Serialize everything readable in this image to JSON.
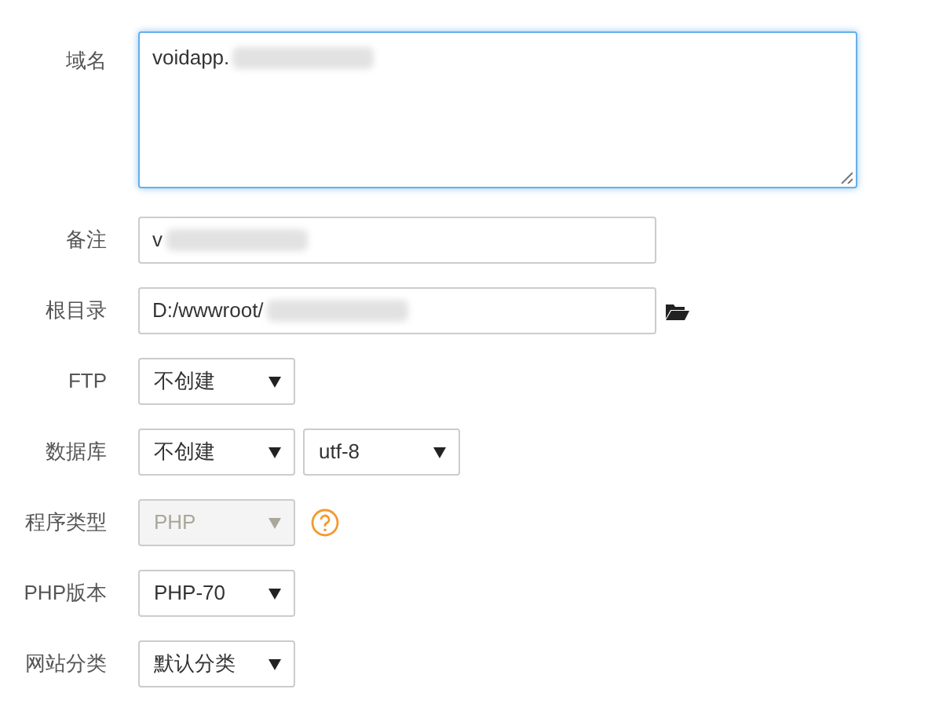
{
  "form": [
    {
      "label": "域名",
      "kind": "textarea",
      "value": "voidapp.",
      "redacted": true,
      "focused": true
    },
    {
      "label": "备注",
      "kind": "text",
      "value": "v",
      "redacted": true
    },
    {
      "label": "根目录",
      "kind": "path",
      "value": "D:/wwwroot/",
      "redacted": true
    },
    {
      "label": "FTP",
      "kind": "select",
      "selects": [
        {
          "value": "不创建",
          "disabled": false
        }
      ]
    },
    {
      "label": "数据库",
      "kind": "select",
      "selects": [
        {
          "value": "不创建",
          "disabled": false
        },
        {
          "value": "utf-8",
          "disabled": false
        }
      ]
    },
    {
      "label": "程序类型",
      "kind": "select",
      "selects": [
        {
          "value": "PHP",
          "disabled": true
        }
      ],
      "help": true
    },
    {
      "label": "PHP版本",
      "kind": "select",
      "selects": [
        {
          "value": "PHP-70",
          "disabled": false
        }
      ]
    },
    {
      "label": "网站分类",
      "kind": "select",
      "selects": [
        {
          "value": "默认分类",
          "disabled": false
        }
      ]
    }
  ]
}
